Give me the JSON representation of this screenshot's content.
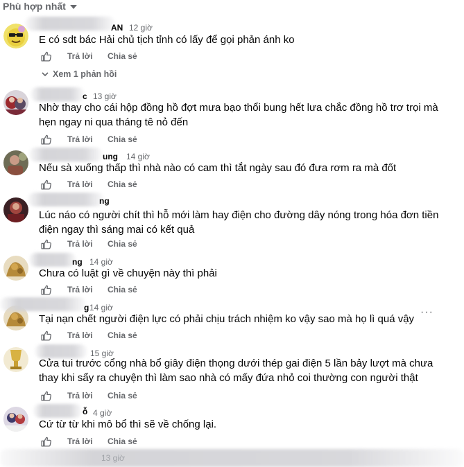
{
  "sort": {
    "label": "Phù hợp nhất"
  },
  "actions": {
    "reply": "Trả lời",
    "share": "Chia sẻ"
  },
  "comments": [
    {
      "name_fragment": "AN",
      "time": "12 giờ",
      "text": "E có sdt bác Hải chủ tịch tỉnh có lấy để gọi phản ánh ko",
      "replies": "Xem 1 phản hồi"
    },
    {
      "name_fragment": "c",
      "time": "13 giờ",
      "text": "Nhờ thay cho cái hộp đồng hồ đợt mưa bạo thổi bung hết lưa chắc đồng hồ trơ trọi mà hẹn ngay ni qua tháng tê nỏ đến"
    },
    {
      "name_fragment": "ung",
      "time": "14 giờ",
      "text": "Nếu sà xuống thấp thì nhà nào có cam thì tắt ngày sau đó đưa rơm ra mà đốt"
    },
    {
      "name_fragment": "ng",
      "time": "",
      "text": "Lúc náo có người chít thì hỗ mới làm hay điện cho đường dây nóng trong hóa đơn tiền điện ngay thì sáng mai có kết quả"
    },
    {
      "name_fragment": "ng",
      "time": "14 giờ",
      "text": "Chưa có luật gì về chuyện này thì phải"
    },
    {
      "name_fragment": "g",
      "time": "14 giờ",
      "text": "Tại nạn chết người điện lực có phải chịu trách nhiệm ko vậy sao mà họ lì quá vậy",
      "more": "···"
    },
    {
      "name_fragment": "",
      "time": "15 giờ",
      "text": "Cửa tui trước cổng nhà bổ giây điện thọng dưới thép gai điện 5 lần bảy lượt mà chưa thay khi sẩy ra chuyện thì làm sao nhà có mấy đứa nhỏ coi thường con người thật"
    },
    {
      "name_fragment": "ỗ",
      "time": "4 giờ",
      "text": "Cứ từ từ khi mô bổ thì sẽ về chống lại."
    },
    {
      "name_fragment": "",
      "time": "13 giờ",
      "text": ""
    }
  ]
}
